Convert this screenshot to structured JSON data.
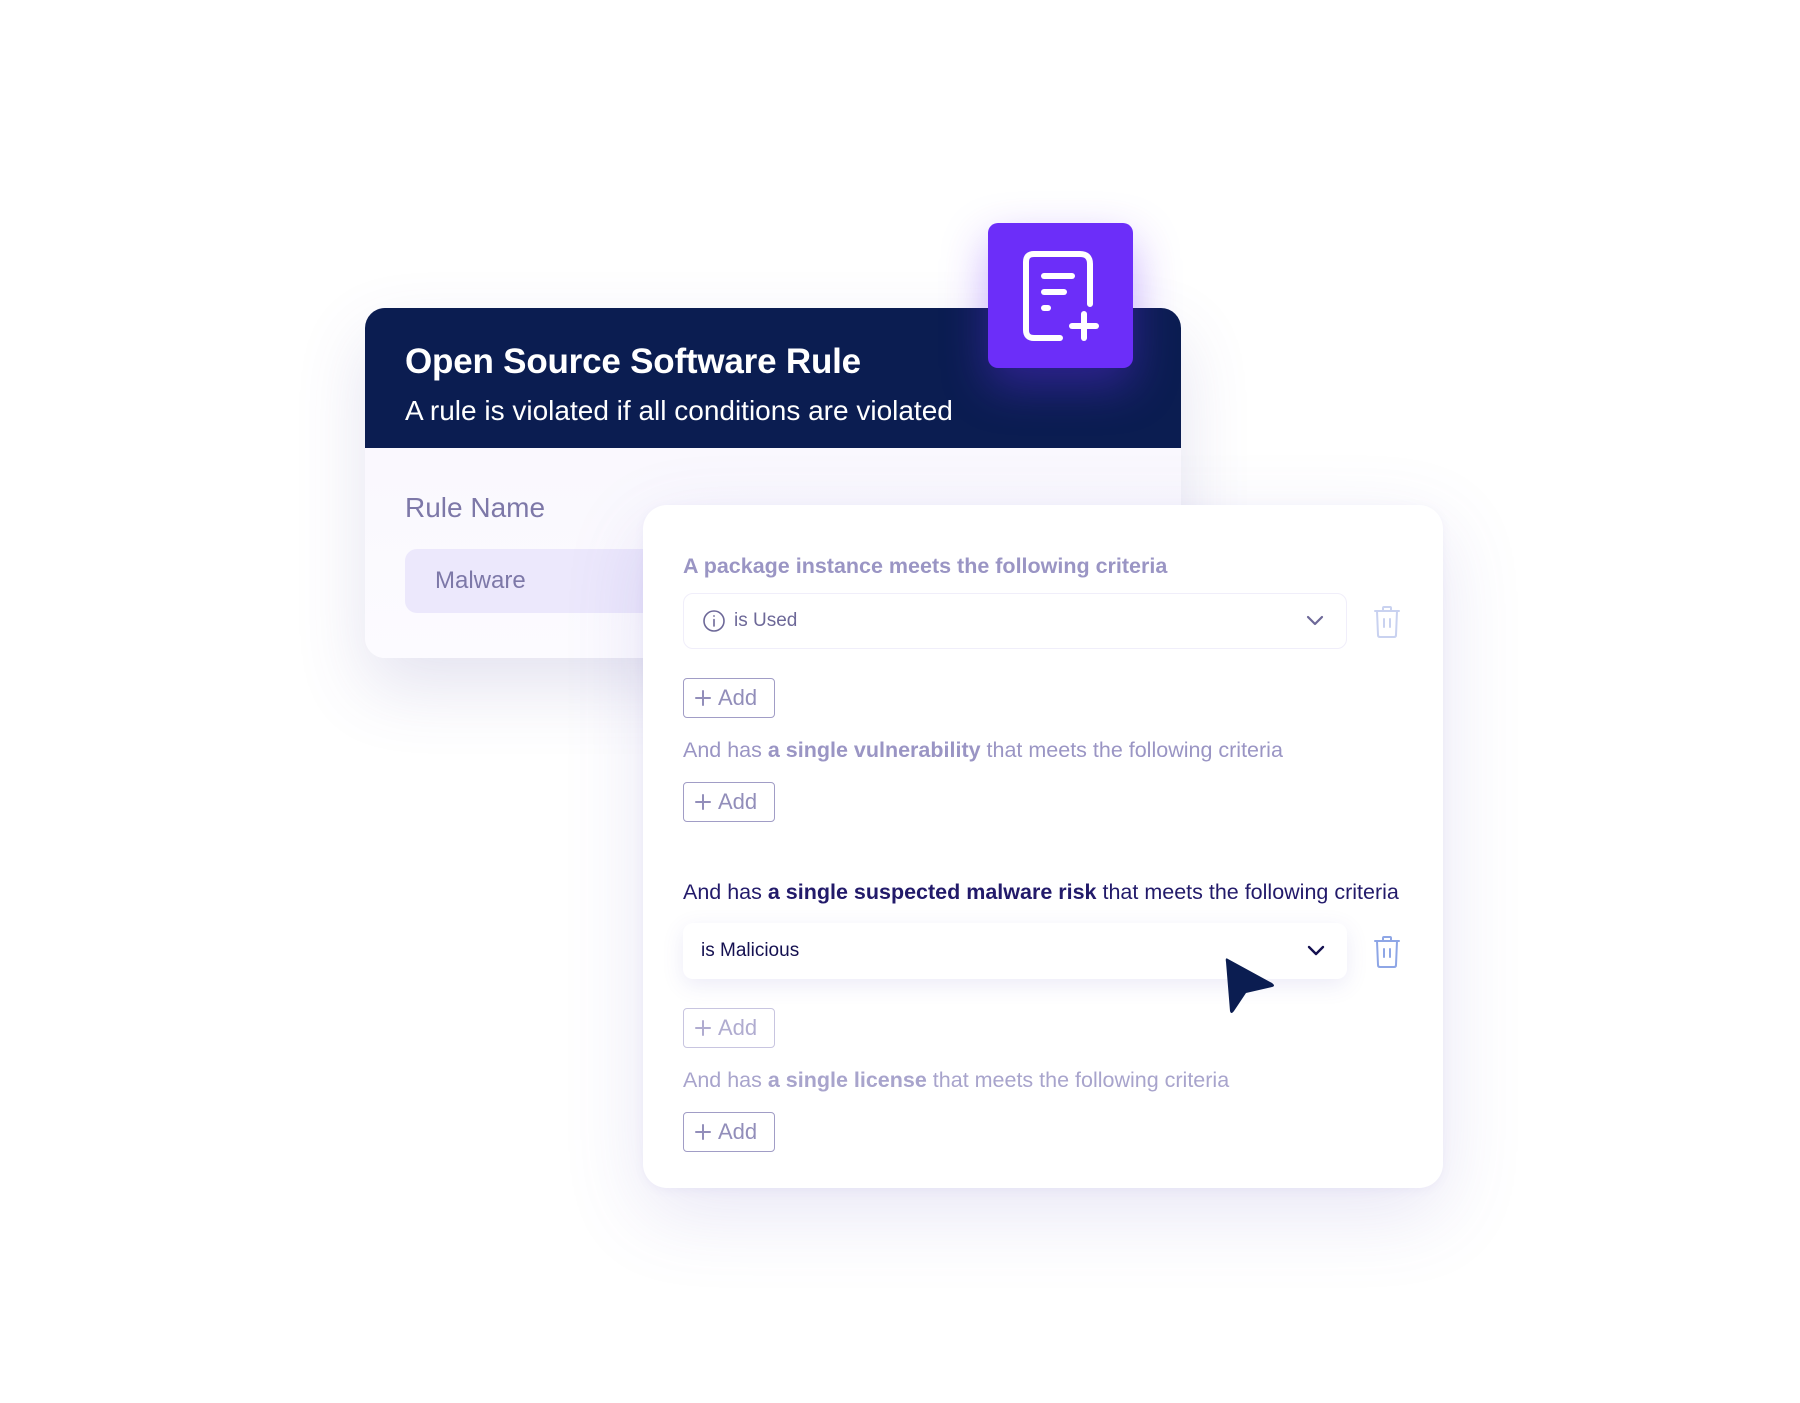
{
  "rule_card": {
    "title": "Open Source Software Rule",
    "subtitle": "A rule is violated if all conditions are violated",
    "rule_name_label": "Rule Name",
    "rule_name_value": "Malware",
    "badge_icon": "document-add-icon"
  },
  "criteria": {
    "package": {
      "heading": "A package instance meets the following criteria",
      "select_value": "is Used",
      "icon": "info-icon",
      "add_label": "Add"
    },
    "vulnerability": {
      "heading_prefix": "And has ",
      "heading_bold": "a single vulnerability",
      "heading_suffix": " that meets the following criteria",
      "add_label": "Add"
    },
    "malware": {
      "heading_prefix": "And has ",
      "heading_bold": "a single suspected malware risk",
      "heading_suffix": " that meets the following criteria",
      "select_value": "is Malicious",
      "add_label": "Add"
    },
    "license": {
      "heading_prefix": "And has ",
      "heading_bold": "a single license",
      "heading_suffix": " that meets the following criteria",
      "add_label": "Add"
    }
  },
  "colors": {
    "header_navy": "#0b1d51",
    "accent_purple": "#6c2ef9",
    "active_text": "#221a6a",
    "muted_text": "#9a95c4"
  }
}
